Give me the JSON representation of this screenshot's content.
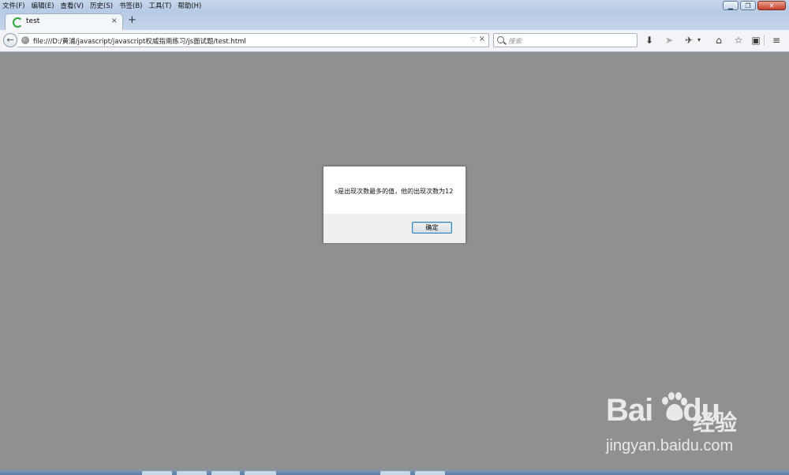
{
  "menu": [
    "文件(F)",
    "编辑(E)",
    "查看(V)",
    "历史(S)",
    "书签(B)",
    "工具(T)",
    "帮助(H)"
  ],
  "tab": {
    "title": "test",
    "close": "×",
    "new_tab": "+"
  },
  "nav": {
    "back": "←",
    "url": "file:///D:/黄浦/javascript/javascript权威指南练习/js面试题/test.html",
    "url_dropdown": "▽",
    "url_clear": "×",
    "search_placeholder": "搜索"
  },
  "toolbar_icons": [
    "download-icon",
    "send-icon",
    "tools-icon",
    "home-icon",
    "bookmark-star-icon",
    "clipboard-icon",
    "menu-icon"
  ],
  "dialog": {
    "message": "s是出现次数最多的值，他的出现次数为12",
    "ok_label": "确定"
  },
  "watermark": {
    "logo": "Bai",
    "logo_tail": "du",
    "cn": "经验",
    "url": "jingyan.baidu.com"
  },
  "colors": {
    "page_bg": "#8f9092",
    "tab_icon": "#2fa53b",
    "button_border": "#3c7fb1"
  }
}
